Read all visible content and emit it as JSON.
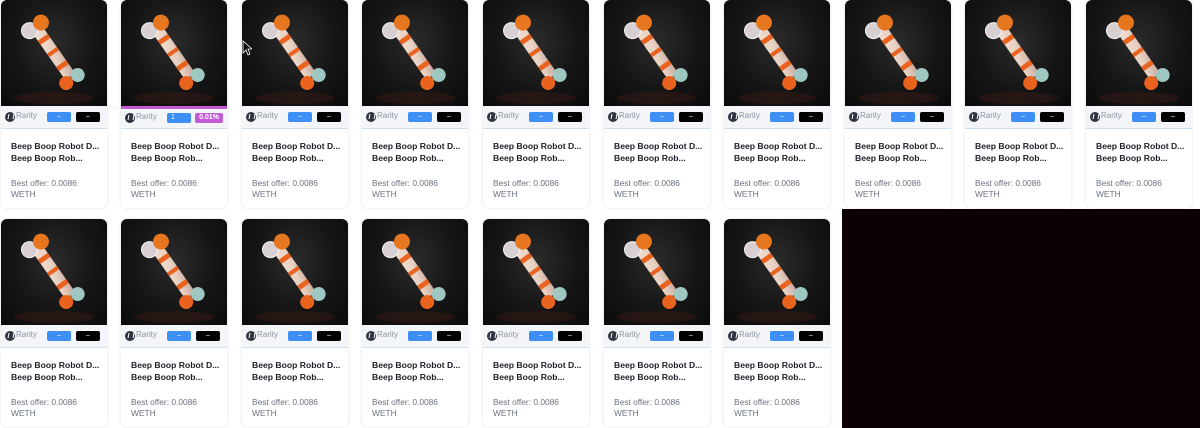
{
  "colors": {
    "rank_pill": "#3d8ef5",
    "pct_pill": "#000000",
    "highlight_accent": "#c35bd7",
    "dark_panel": "#0c0203"
  },
  "cards": [
    {
      "rarity_label": "Rarity",
      "rank": "–",
      "pct": "–",
      "name_line1": "Beep Boop Robot D...",
      "name_line2": "Beep Boop Rob...",
      "offer_line1": "Best offer: 0.0086",
      "offer_line2": "WETH",
      "highlighted": false
    },
    {
      "rarity_label": "Rarity",
      "rank": "1",
      "pct": "0.01%",
      "name_line1": "Beep Boop Robot D...",
      "name_line2": "Beep Boop Rob...",
      "offer_line1": "Best offer: 0.0086",
      "offer_line2": "WETH",
      "highlighted": true
    },
    {
      "rarity_label": "Rarity",
      "rank": "–",
      "pct": "–",
      "name_line1": "Beep Boop Robot D...",
      "name_line2": "Beep Boop Rob...",
      "offer_line1": "Best offer: 0.0086",
      "offer_line2": "WETH",
      "highlighted": false
    },
    {
      "rarity_label": "Rarity",
      "rank": "–",
      "pct": "–",
      "name_line1": "Beep Boop Robot D...",
      "name_line2": "Beep Boop Rob...",
      "offer_line1": "Best offer: 0.0086",
      "offer_line2": "WETH",
      "highlighted": false
    },
    {
      "rarity_label": "Rarity",
      "rank": "–",
      "pct": "–",
      "name_line1": "Beep Boop Robot D...",
      "name_line2": "Beep Boop Rob...",
      "offer_line1": "Best offer: 0.0086",
      "offer_line2": "WETH",
      "highlighted": false
    },
    {
      "rarity_label": "Rarity",
      "rank": "–",
      "pct": "–",
      "name_line1": "Beep Boop Robot D...",
      "name_line2": "Beep Boop Rob...",
      "offer_line1": "Best offer: 0.0086",
      "offer_line2": "WETH",
      "highlighted": false
    },
    {
      "rarity_label": "Rarity",
      "rank": "–",
      "pct": "–",
      "name_line1": "Beep Boop Robot D...",
      "name_line2": "Beep Boop Rob...",
      "offer_line1": "Best offer: 0.0086",
      "offer_line2": "WETH",
      "highlighted": false
    },
    {
      "rarity_label": "Rarity",
      "rank": "–",
      "pct": "–",
      "name_line1": "Beep Boop Robot D...",
      "name_line2": "Beep Boop Rob...",
      "offer_line1": "Best offer: 0.0086",
      "offer_line2": "WETH",
      "highlighted": false
    },
    {
      "rarity_label": "Rarity",
      "rank": "–",
      "pct": "–",
      "name_line1": "Beep Boop Robot D...",
      "name_line2": "Beep Boop Rob...",
      "offer_line1": "Best offer: 0.0086",
      "offer_line2": "WETH",
      "highlighted": false
    },
    {
      "rarity_label": "Rarity",
      "rank": "–",
      "pct": "–",
      "name_line1": "Beep Boop Robot D...",
      "name_line2": "Beep Boop Rob...",
      "offer_line1": "Best offer: 0.0086",
      "offer_line2": "WETH",
      "highlighted": false
    },
    {
      "rarity_label": "Rarity",
      "rank": "–",
      "pct": "–",
      "name_line1": "Beep Boop Robot D...",
      "name_line2": "Beep Boop Rob...",
      "offer_line1": "Best offer: 0.0086",
      "offer_line2": "WETH",
      "highlighted": false
    },
    {
      "rarity_label": "Rarity",
      "rank": "–",
      "pct": "–",
      "name_line1": "Beep Boop Robot D...",
      "name_line2": "Beep Boop Rob...",
      "offer_line1": "Best offer: 0.0086",
      "offer_line2": "WETH",
      "highlighted": false
    },
    {
      "rarity_label": "Rarity",
      "rank": "–",
      "pct": "–",
      "name_line1": "Beep Boop Robot D...",
      "name_line2": "Beep Boop Rob...",
      "offer_line1": "Best offer: 0.0086",
      "offer_line2": "WETH",
      "highlighted": false
    },
    {
      "rarity_label": "Rarity",
      "rank": "–",
      "pct": "–",
      "name_line1": "Beep Boop Robot D...",
      "name_line2": "Beep Boop Rob...",
      "offer_line1": "Best offer: 0.0086",
      "offer_line2": "WETH",
      "highlighted": false
    },
    {
      "rarity_label": "Rarity",
      "rank": "–",
      "pct": "–",
      "name_line1": "Beep Boop Robot D...",
      "name_line2": "Beep Boop Rob...",
      "offer_line1": "Best offer: 0.0086",
      "offer_line2": "WETH",
      "highlighted": false
    },
    {
      "rarity_label": "Rarity",
      "rank": "–",
      "pct": "–",
      "name_line1": "Beep Boop Robot D...",
      "name_line2": "Beep Boop Rob...",
      "offer_line1": "Best offer: 0.0086",
      "offer_line2": "WETH",
      "highlighted": false
    },
    {
      "rarity_label": "Rarity",
      "rank": "–",
      "pct": "–",
      "name_line1": "Beep Boop Robot D...",
      "name_line2": "Beep Boop Rob...",
      "offer_line1": "Best offer: 0.0086",
      "offer_line2": "WETH",
      "highlighted": false
    }
  ]
}
